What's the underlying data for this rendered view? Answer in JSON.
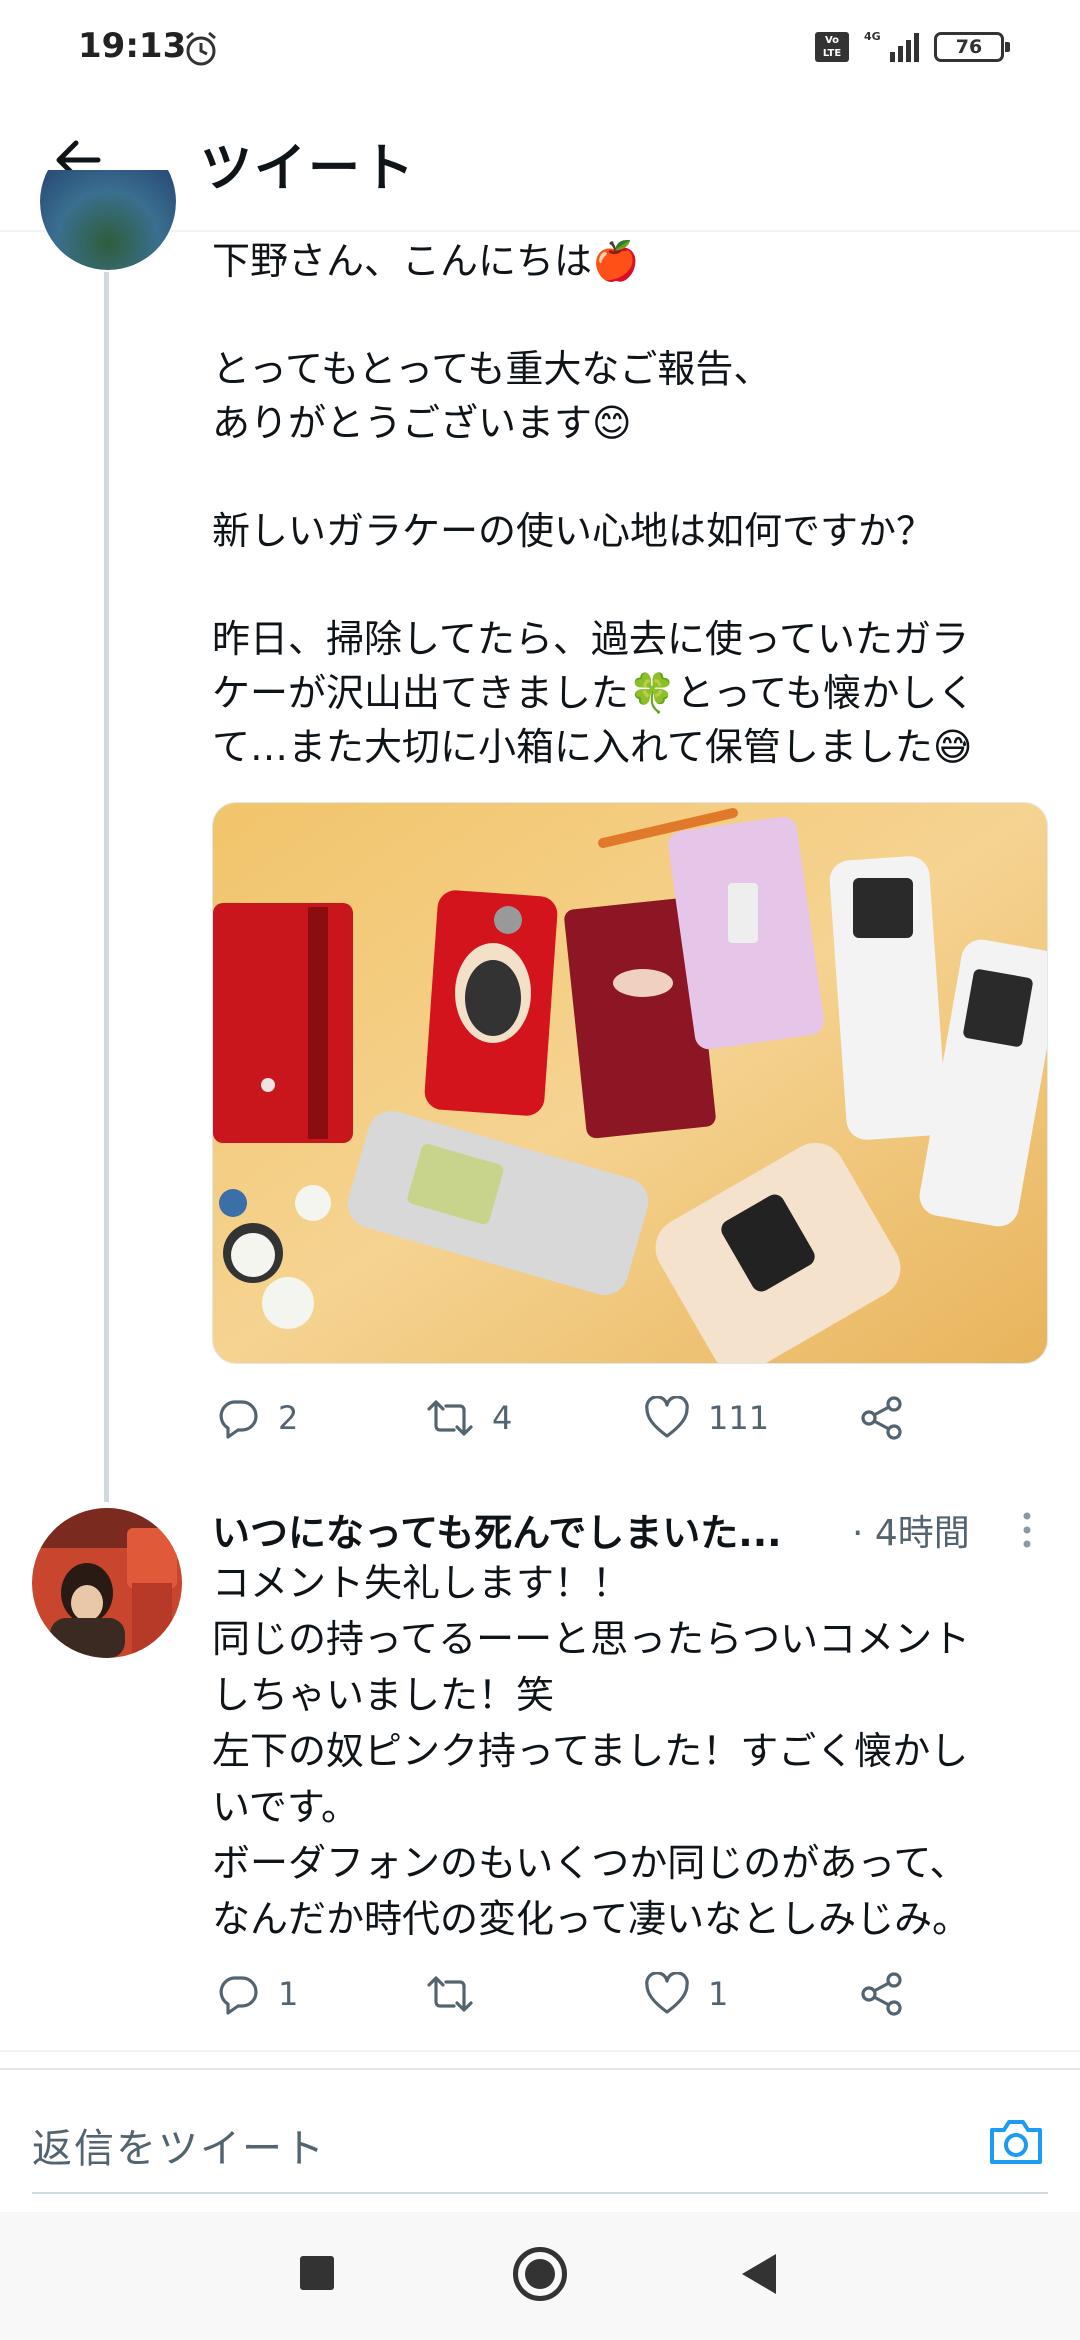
{
  "status_bar": {
    "time": "19:13",
    "volte": "Vo LTE",
    "network": "4G",
    "battery": "76"
  },
  "header": {
    "title": "ツイート"
  },
  "tweet": {
    "lines": [
      "下野さん、こんにちは🍎",
      "",
      "とってもとっても重大なご報告、",
      "ありがとうございます😊",
      "",
      "新しいガラケーの使い心地は如何ですか？",
      "",
      "昨日、掃除してたら、過去に使っていたガラ",
      "ケーが沢山出てきました🍀とっても懐かしく",
      "て…また大切に小箱に入れて保管しました😅"
    ],
    "actions": {
      "replies": "2",
      "retweets": "4",
      "likes": "111"
    }
  },
  "reply": {
    "name": "いつになっても死んでしまいた...",
    "time": "· 4時間",
    "lines": [
      "コメント失礼します！！",
      "同じの持ってるーーと思ったらついコメント",
      "しちゃいました！笑",
      "左下の奴ピンク持ってました！すごく懐かし",
      "いです。",
      "ボーダフォンのもいくつか同じのがあって、",
      "なんだか時代の変化って凄いなとしみじみ。"
    ],
    "actions": {
      "replies": "1",
      "retweets": "",
      "likes": "1"
    }
  },
  "composer": {
    "placeholder": "返信をツイート"
  },
  "colors": {
    "accent": "#1d9bf0",
    "muted": "#536471",
    "thread_line": "#cfd9de"
  },
  "icons": [
    "alarm-icon",
    "signal-icon",
    "back-arrow-icon",
    "reply-icon",
    "retweet-icon",
    "like-icon",
    "share-icon",
    "more-icon",
    "camera-icon"
  ]
}
